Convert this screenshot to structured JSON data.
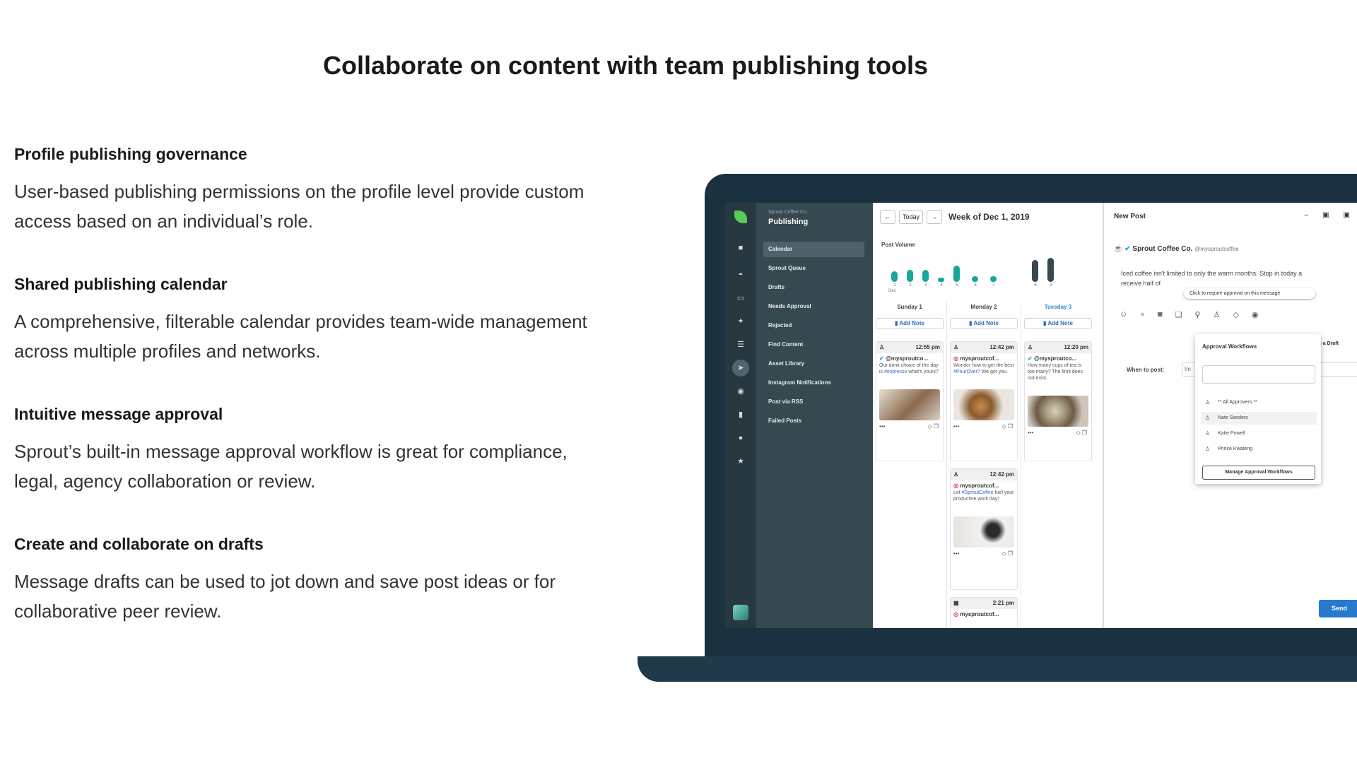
{
  "headline": "Collaborate on content with team publishing tools",
  "features": [
    {
      "title": "Profile publishing governance",
      "body": "User-based publishing permissions on the profile level provide custom access based on an individual’s role."
    },
    {
      "title": "Shared publishing calendar",
      "body": "A comprehensive, filterable calendar provides team-wide management across multiple profiles and networks."
    },
    {
      "title": "Intuitive message approval",
      "body": "Sprout’s built-in message approval workflow is great for compliance, legal, agency collaboration or review."
    },
    {
      "title": "Create and collaborate on drafts",
      "body": "Message drafts can be used to jot down and save post ideas or for collaborative peer review."
    }
  ],
  "app": {
    "org_name": "Sprout Coffee Co.",
    "section_title": "Publishing",
    "nav_items": [
      "Calendar",
      "Sprout Queue",
      "Drafts",
      "Needs Approval",
      "Rejected",
      "Find Content",
      "Asset Library",
      "Instagram Notifications",
      "Post via RSS",
      "Failed Posts"
    ],
    "calendar": {
      "prev": "←",
      "today": "Today",
      "next": "→",
      "week_label": "Week of Dec 1, 2019",
      "post_volume_label": "Post Volume",
      "month_label": "Dec",
      "days": [
        {
          "label": "1",
          "level": 0.35
        },
        {
          "label": "2",
          "level": 0.4
        },
        {
          "label": "3",
          "level": 0.4
        },
        {
          "label": "4",
          "level": 0.1
        },
        {
          "label": "5",
          "level": 0.55
        },
        {
          "label": "6",
          "level": 0.2
        },
        {
          "label": "7",
          "level": 0.2
        },
        {
          "label": "8",
          "level": 0.75
        },
        {
          "label": "9",
          "level": 0.8
        }
      ],
      "columns": [
        {
          "label": "Sunday 1",
          "add_note": "Add Note"
        },
        {
          "label": "Monday 2",
          "add_note": "Add Note"
        },
        {
          "label": "Tuesday 3",
          "add_note": "Add Note"
        }
      ],
      "cards": [
        {
          "time": "12:55 pm",
          "handle": "@mysproutco...",
          "text_a": "Our drink choice of the day is ",
          "tag": "#espresso",
          "text_b": " what's yours?"
        },
        {
          "time": "12:42 pm",
          "handle": "mysproutcof...",
          "text_a": "Wonder how to get the best ",
          "tag": "#PourOver?",
          "text_b": " We got you."
        },
        {
          "time": "12:20 pm",
          "handle": "@mysproutco...",
          "text_a": "How many cups of tea is too many? The limit does not exist.",
          "tag": "",
          "text_b": ""
        },
        {
          "time": "12:42 pm",
          "handle": "mysproutcof...",
          "text_a": "Let ",
          "tag": "#SproutCoffee",
          "text_b": " fuel your productive work day!"
        },
        {
          "time": "2:21 pm",
          "handle": "mysproutcof...",
          "text_a": "",
          "tag": "",
          "text_b": ""
        }
      ],
      "more": "•••"
    },
    "new_post": {
      "title": "New Post",
      "minimize": "–",
      "profile_name": "Sprout Coffee Co.",
      "profile_handle": "@mysproutcoffee",
      "message_line1": "Iced coffee isn't limited to only the warm months. Stop in today a",
      "message_line2": "receive half of",
      "tooltip": "Click to require approval on this message",
      "draft_note": "is a Draft",
      "when_label": "When to post:",
      "when_value": "Im",
      "popover_title": "Approval Workflows",
      "approvers": [
        "** All Approvers **",
        "Nate Sanders",
        "Katie Powell",
        "Prince Kwateng"
      ],
      "manage_button": "Manage Approval Workflows",
      "send": "Send"
    }
  },
  "colors": {
    "teal": "#18a69a",
    "link_blue": "#2c89d6",
    "send_blue": "#2878d0",
    "laptop": "#1c3140",
    "nav": "#364850"
  }
}
